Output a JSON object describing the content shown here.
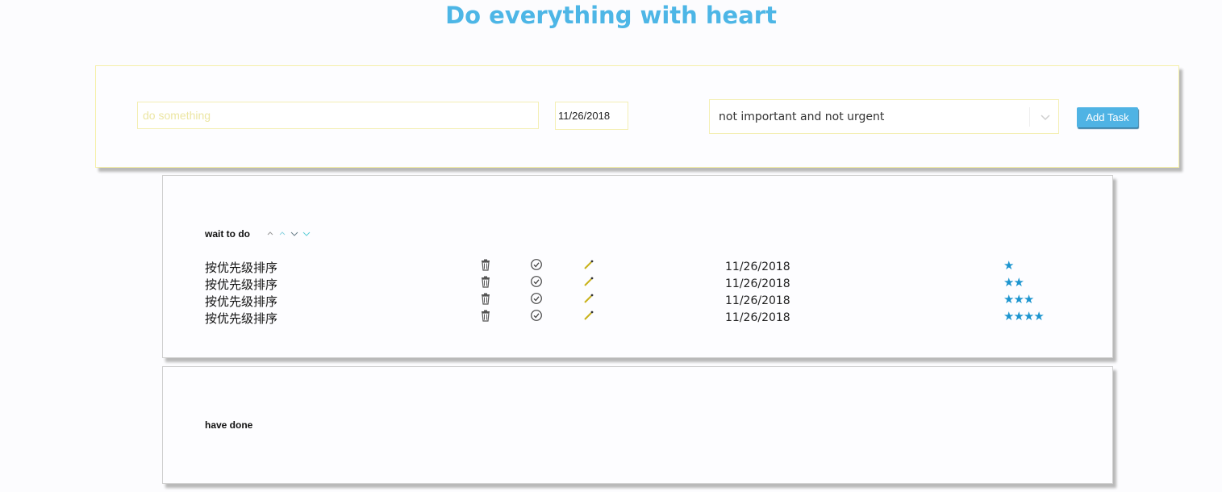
{
  "header": {
    "title": "Do everything with heart"
  },
  "add_form": {
    "task_placeholder": "do something",
    "date_value": "11/26/2018",
    "priority_selected": "not important and not urgent",
    "add_label": "Add Task"
  },
  "todo": {
    "label": "wait to do",
    "items": [
      {
        "text": "按优先级排序",
        "date": "11/26/2018",
        "stars": "★",
        "priority": 1
      },
      {
        "text": "按优先级排序",
        "date": "11/26/2018",
        "stars": "★★",
        "priority": 2
      },
      {
        "text": "按优先级排序",
        "date": "11/26/2018",
        "stars": "★★★",
        "priority": 3
      },
      {
        "text": "按优先级排序",
        "date": "11/26/2018",
        "stars": "★★★★",
        "priority": 4
      }
    ]
  },
  "done": {
    "label": "have done"
  },
  "colors": {
    "accent": "#4db6e6",
    "star": "#1c95cf",
    "border_yellow": "#f5f0a8"
  },
  "icons": {
    "delete": "trash-icon",
    "complete": "check-circle-icon",
    "edit": "pencil-icon",
    "sort": "sort-arrows-icon"
  }
}
